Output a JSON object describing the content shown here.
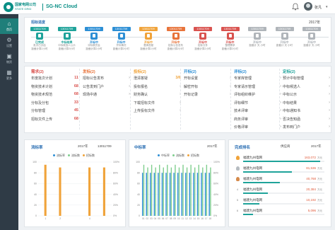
{
  "header": {
    "logo_cn": "国家电网公司",
    "logo_en": "STATE GRID",
    "app_title": "SG-NC Cloud",
    "user_name": "张凡",
    "icons": {
      "bell": "bell-icon",
      "avatar": "avatar",
      "caret": "chevron-down-icon"
    }
  },
  "sidebar": {
    "items": [
      {
        "label": "首页",
        "icon": "home-icon",
        "active": true
      },
      {
        "label": "设置",
        "icon": "gear-icon",
        "active": false
      },
      {
        "label": "物资",
        "icon": "box-icon",
        "active": false
      },
      {
        "label": "更多",
        "icon": "grid-icon",
        "active": false
      }
    ]
  },
  "progress": {
    "title": "招标进度",
    "year": "2017年",
    "stages": [
      {
        "badge": "13011709",
        "name": "已完成",
        "sub": "批次已办结",
        "time": "距截计算2小时",
        "color": "#1fa39a"
      },
      {
        "badge": "13011709",
        "name": "中标结果",
        "sub": "中标候选人公示",
        "time": "距截计算2小时",
        "color": "#1fa39a"
      },
      {
        "badge": "13011709",
        "name": "开标中",
        "sub": "评标委员会",
        "time": "距截计算2小时",
        "color": "#2d8fd5"
      },
      {
        "badge": "13011709",
        "name": "开标中",
        "sub": "开标情况",
        "time": "距截计算2小时",
        "color": "#2d8fd5"
      },
      {
        "badge": "13011709",
        "name": "开标中",
        "sub": "澄清答疑",
        "time": "距截计算2小时",
        "color": "#f0a33a"
      },
      {
        "badge": "13011709",
        "name": "开标中",
        "sub": "招标公告发布",
        "time": "距截计算2小时",
        "color": "#e8743b"
      },
      {
        "badge": "13011709",
        "name": "开标中",
        "sub": "招标文件",
        "time": "距截计算2小时",
        "color": "#d9534f"
      },
      {
        "badge": "13011709",
        "name": "开标中",
        "sub": "整理需求",
        "time": "距截计算2小时",
        "color": "#d9534f"
      },
      {
        "badge": "13011709",
        "name": "开标中",
        "sub": "",
        "time": "距截计 天 小时",
        "color": "#b0b5ba"
      },
      {
        "badge": "13011709",
        "name": "开标中",
        "sub": "",
        "time": "距截计 天 小时",
        "color": "#b0b5ba"
      },
      {
        "badge": "13011709",
        "name": "开标中",
        "sub": "",
        "time": "距截计 天 小时",
        "color": "#b0b5ba"
      }
    ]
  },
  "cards": [
    {
      "title": "需求(2)",
      "color": "#d9534f",
      "rows": [
        {
          "label": "年度批次计划",
          "count": "11"
        },
        {
          "label": "物资技术计划",
          "count": "68"
        },
        {
          "label": "物资技术规范",
          "count": "68"
        },
        {
          "label": "分标及分包",
          "count": "33"
        },
        {
          "label": "分标管理",
          "count": "45"
        },
        {
          "label": "招标文件上传",
          "count": "68"
        }
      ]
    },
    {
      "title": "发标(2)",
      "color": "#e8743b",
      "rows": [
        {
          "label": "招标公告发布",
          "count": ""
        },
        {
          "label": "公告发到门户",
          "count": ""
        },
        {
          "label": "现场中通",
          "count": ""
        }
      ]
    },
    {
      "title": "投标(2)",
      "color": "#f0a33a",
      "rows": [
        {
          "label": "澄清答疑",
          "count": "3/6"
        },
        {
          "label": "投标报名",
          "count": ""
        },
        {
          "label": "财务确认",
          "count": ""
        },
        {
          "label": "下载招标文件",
          "count": ""
        },
        {
          "label": "上传投标文件",
          "count": ""
        }
      ]
    },
    {
      "title": "开标(2)",
      "color": "#2d8fd5",
      "rows": [
        {
          "label": "开标设置",
          "count": ""
        },
        {
          "label": "解密开标",
          "count": ""
        },
        {
          "label": "开标记录",
          "count": ""
        }
      ]
    },
    {
      "title": "评标(2)",
      "color": "#2d8fd5",
      "rows": [
        {
          "label": "专家库管理",
          "count": ""
        },
        {
          "label": "专家请示管理",
          "count": ""
        },
        {
          "label": "评标组织维护",
          "count": ""
        },
        {
          "label": "评标细节",
          "count": ""
        },
        {
          "label": "技术评审",
          "count": ""
        },
        {
          "label": "商务评审",
          "count": ""
        },
        {
          "label": "价格评审",
          "count": ""
        }
      ]
    },
    {
      "title": "定标(2)",
      "color": "#1fa39a",
      "rows": [
        {
          "label": "预计中标管理",
          "count": ""
        },
        {
          "label": "中标候选人",
          "count": ""
        },
        {
          "label": "中标公示",
          "count": ""
        },
        {
          "label": "中标结果",
          "count": ""
        },
        {
          "label": "中标通知书",
          "count": ""
        },
        {
          "label": "否决告知函",
          "count": ""
        },
        {
          "label": "发布到门户",
          "count": ""
        }
      ]
    }
  ],
  "chart_liubiao": {
    "title": "流标率",
    "year": "2017年",
    "batch": "13011709",
    "legend": [
      "流标率",
      "流标数",
      "招标数"
    ]
  },
  "chart_zhongbiao": {
    "title": "中标率",
    "year": "2017年",
    "legend": [
      "中标率",
      "流标数",
      "招标数"
    ]
  },
  "ranking": {
    "title": "完成排名",
    "filter": "供应商",
    "year": "2017年",
    "items": [
      {
        "name": "福建九州电网",
        "value": "163,072",
        "unit": "万元",
        "ratio": 0.95
      },
      {
        "name": "福建九州电网",
        "value": "81,536",
        "unit": "万元",
        "ratio": 0.6
      },
      {
        "name": "福建九州电网",
        "value": "40,768",
        "unit": "万元",
        "ratio": 0.45
      },
      {
        "name": "福建九州电网",
        "value": "20,384",
        "unit": "万元",
        "ratio": 0.3
      },
      {
        "name": "福建九州电网",
        "value": "10,192",
        "unit": "万元",
        "ratio": 0.2
      },
      {
        "name": "福建九州电网",
        "value": "5,096",
        "unit": "万元",
        "ratio": 0.12
      }
    ]
  },
  "chart_data": [
    {
      "type": "bar",
      "title": "流标率",
      "categories": [
        "1",
        "2",
        "3",
        "4",
        "5"
      ],
      "x_labels": [
        "1",
        "2",
        "",
        "4",
        ""
      ],
      "series": [
        {
          "name": "流标率",
          "values": [
            0,
            0,
            0,
            0,
            0
          ],
          "color": "#2d8fd5"
        },
        {
          "name": "流标数",
          "values": [
            0,
            0,
            0,
            0,
            0
          ],
          "color": "#7fce8e"
        },
        {
          "name": "招标数",
          "values": [
            95,
            90,
            0,
            90,
            90
          ],
          "color": "#f0a33a"
        }
      ],
      "ylim": [
        0,
        100
      ],
      "y_ticks_left": [
        "100",
        "80",
        "60",
        "40",
        "20",
        "0"
      ],
      "y_ticks_right": [
        "100%",
        "80%",
        "60%",
        "40%",
        "20%",
        "0%"
      ]
    },
    {
      "type": "bar",
      "title": "中标率",
      "categories": [
        "01",
        "02",
        "03",
        "04",
        "05",
        "06",
        "07",
        "08",
        "09",
        "10",
        "11",
        "12",
        "13",
        "14",
        "15",
        "16",
        "17",
        "18"
      ],
      "series": [
        {
          "name": "中标率",
          "values": [
            80,
            80,
            80,
            80,
            80,
            80,
            80,
            80,
            80,
            80,
            80,
            80,
            80,
            80,
            80,
            80,
            80,
            80
          ],
          "color": "#2d8fd5"
        },
        {
          "name": "流标数",
          "values": [
            95,
            90,
            95,
            90,
            95,
            90,
            95,
            90,
            95,
            90,
            95,
            90,
            95,
            90,
            95,
            90,
            95,
            90
          ],
          "color": "#7fce8e"
        },
        {
          "name": "招标数",
          "values": [
            0,
            0,
            0,
            0,
            0,
            0,
            0,
            0,
            0,
            0,
            0,
            0,
            0,
            0,
            0,
            0,
            0,
            0
          ],
          "color": "#f0a33a"
        }
      ],
      "ylim": [
        0,
        100
      ],
      "y_ticks_left": [
        "100",
        "80",
        "60",
        "40",
        "20",
        "0"
      ],
      "y_ticks_right": [
        "100%",
        "80%",
        "60%",
        "40%",
        "20%",
        "0%"
      ]
    }
  ]
}
